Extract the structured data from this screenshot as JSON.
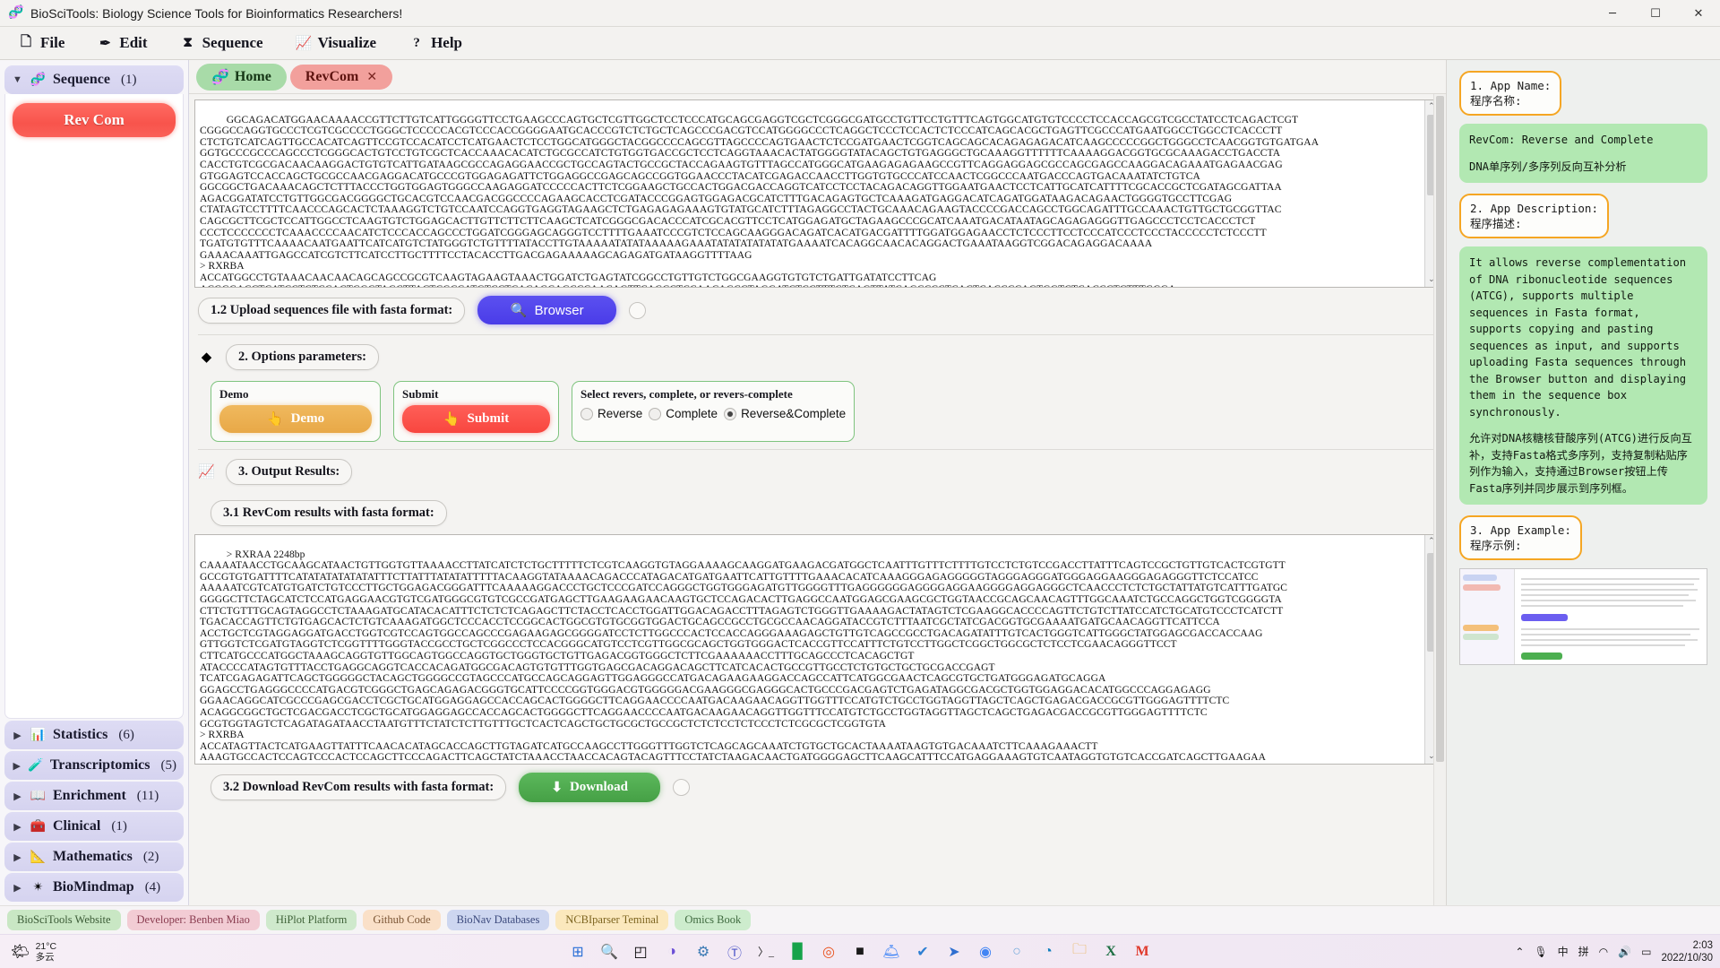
{
  "window": {
    "title": "BioSciTools: Biology Science Tools for Bioinformatics Researchers!",
    "app_icon": "dna-icon",
    "minimize": "─",
    "maximize": "☐",
    "close": "✕"
  },
  "menu": [
    {
      "label": "File",
      "icon": "file-icon",
      "glyph": "🗋"
    },
    {
      "label": "Edit",
      "icon": "pen-icon",
      "glyph": "✒"
    },
    {
      "label": "Sequence",
      "icon": "sequence-icon",
      "glyph": "⧗"
    },
    {
      "label": "Visualize",
      "icon": "chart-icon",
      "glyph": "📈"
    },
    {
      "label": "Help",
      "icon": "question-icon",
      "glyph": "?"
    }
  ],
  "sidebar": {
    "active_group": {
      "label": "Sequence",
      "count": "(1)",
      "caret": "▼",
      "icon": "dna-icon",
      "glyph": "🧬"
    },
    "active_items": [
      {
        "label": "Rev Com",
        "name": "rev-com-button"
      }
    ],
    "groups": [
      {
        "label": "Statistics",
        "count": "(6)",
        "caret": "▶",
        "icon": "statistics-icon",
        "glyph": "📊"
      },
      {
        "label": "Transcriptomics",
        "count": "(5)",
        "caret": "▶",
        "icon": "transcriptomics-icon",
        "glyph": "🧪"
      },
      {
        "label": "Enrichment",
        "count": "(11)",
        "caret": "▶",
        "icon": "enrichment-icon",
        "glyph": "📖"
      },
      {
        "label": "Clinical",
        "count": "(1)",
        "caret": "▶",
        "icon": "clinical-icon",
        "glyph": "🧰"
      },
      {
        "label": "Mathematics",
        "count": "(2)",
        "caret": "▶",
        "icon": "mathematics-icon",
        "glyph": "📐"
      },
      {
        "label": "BioMindmap",
        "count": "(4)",
        "caret": "▶",
        "icon": "mindmap-icon",
        "glyph": "✴"
      }
    ]
  },
  "tabs": [
    {
      "label": "Home",
      "icon": "dna-icon",
      "glyph": "🧬",
      "active": false,
      "closable": false
    },
    {
      "label": "RevCom",
      "icon": "none",
      "glyph": "",
      "active": true,
      "closable": true,
      "close_glyph": "✕"
    }
  ],
  "main": {
    "input_sequence": "GGCAGACATGGAACAAAACCGTTCTTGTCATTGGGGTTCCTGAAGCCCAGTGCTCGTTGGCTCCTCCCATGCAGCGAGGTCGCTCGGGCGATGCCTGTTCCTGTTTCAGTGGCATGTGTCCCCTCCACCAGCGTCGCCTATCCTCAGACTCGT\nCGGGCCAGGTGCCCTCGTCGCCCCTGGGCTCCCCCACGTCCCACCGGGGAATGCACCCGTCTCTGCTCAGCCCGACGTCCATGGGGCCCTCAGGCTCCCTCCACTCTCCCATCAGCACGCTGAGTTCGCCCATGAATGGCCTGGCCTCACCCTT\nCTCTGTCATCAGTTGCCACATCAGTTCCGTCCACATCCTCATGAACTCTCCTGGCATGGGCTACGGCCCCAGCGTTAGCCCCAGTGAACTCTCCGATGAACTCGGTCAGCAGCACAGAGAGACATCAAGCCCCCGGCTGGGCCTCAACGGTGTGATGAA\nGGTGCCCGCCCAGCCCTCGGGCACTGTCCTGTCGCTCACCAAACACATCTGCGCCATCTGTGGTGACCGCTCCTCAGGTAAACACTATGGGGTATACAGCTGTGAGGGCTGCAAAGGTTTTTTCAAAAGGACGGTGCGCAAAGACCTGACCTA\nCACCTGTCGCGACAACAAGGACTGTGTCATTGATAAGCGCCAGAGGAACCGCTGCCAGTACTGCCGCTACCAGAAGTGTTTAGCCATGGGCATGAAGAGAGAAGCCGTTCAGGAGGAGCGCCAGCGAGCCAAGGACAGAAATGAGAACGAG\nGTGGAGTCCACCAGCTGCGCCAACGAGGACATGCCCGTGGAGAGATTCTGGAGGCCGAGCAGCCGGTGGAACCCTACATCGAGACCAACCTTGGTGTGCCCATCCAACTCGGCCCAATGACCCAGTGACAAATATCTGTCA\nGGCGGCTGACAAACAGCTCTTTACCCTGGTGGAGTGGGCCAAGAGGATCCCCCACTTCTCGGAAGCTGCCACTGGACGACCAGGTCATCCTCCTACAGACAGGTTGGAATGAACTCCTCATTGCATCATTTTCGCACCGCTCGATAGCGATTAA\nAGACGGATATCCTGTTGGCGACGGGGCTGCACGTCCAACGACGGCCCCAGAAGCACCTCGATACCCGGAGTGGAGACGCATCTTTGACAGAGTGCTCAAAGATGAGGACATCAGATGGATAAGACAGAACTGGGGTGCCTTCGAG\nCTATAGTCCTTTTCAACCCAGCACTCTAAAGGTCTGTCCAATCCAGGTGAGGTAGAAGCTCTGAGAGAGAAAGTGTATGCATCTTTAGAGGCCTACTGCAAACAGAAGTACCCCGACCAGCCTGGCAGATTTGCCAAACTGTTGCTGCGGTTAC\nCAGCGCTTCGCTCCATTGGCCTCAAGTGTCTGGAGCACTTGTTCTTCTTCAAGCTCATCGGGCGACACCCATCGCACGTTCCTCATGGAGATGCTAGAAGCCCGCATCAAATGACATAATAGCAGAGAGGGTTGAGCCCTCCTCACCCTCT\nCCCTCCCCCCCTCAAACCCCAACATCTCCCACCAGCCCTGGATCGGGAGCAGGGTCCTTTTGAAATCCCGTCTCCAGCAAGGGACAGATCACATGACGATTTTGGATGGAGAACCTCTCCCTTCCTCCCATCCCTCCCTACCCCCTCTCCCTT\nTGATGTGTTTCAAAACAATGAATTCATCATGTCTATGGGTCTGTTTTATACCTTGTAAAAATATATAAAAAGAAATATATATATATATGAAAATCACAGGCAACACAGGACTGAAATAAGGTCGGACAGAGGACAAAA\nGAAACAAATTGAGCCATCGTCTTCATCCTTGCTTTTCCTACACCTTGACGAGAAAAAGCAGAGATGATAAGGTTTTAAG\n> RXRBA\nACCATGGCCTGTAAACAACAACAGCAGCCGCGTCAAGTAGAAGTAAACTGGATCTGAGTATCGGCCTGTTGTCTGGCGAAGGTGTGTCTGATTGATATCCTTCAG\nACGGGACCTCATCCTCTCCACTGGGTAGCTTACTCGCCATGTCCTCACAGCAGCCCAACAGTTCAGCCTCCAACAGCCTAGGATCTCCTTTCTCAGTTATCAGCCCCTCACTCACCCCAGTGGTCTCACCCTCTTTGGGA\nTTTGGACCCATCAGCAACAGTCAGATCTCTTCTTCAGCACCCATATCAGGGATGCACTCAATCAGCAGCTCAGAAGACA",
    "sequence_scroll": {
      "up_glyph": "⌃",
      "down_glyph": "⌄"
    },
    "upload_label": "1.2 Upload sequences file with fasta format:",
    "browser_button": "Browser",
    "browser_icon": "folder-search-icon",
    "options_header": "2. Options parameters:",
    "options_icon": "diamond-icon",
    "demo": {
      "caption": "Demo",
      "button": "Demo",
      "icon": "hand-icon"
    },
    "submit": {
      "caption": "Submit",
      "button": "Submit",
      "icon": "hand-icon"
    },
    "select": {
      "caption": "Select revers, complete, or revers-complete",
      "options": [
        {
          "label": "Reverse",
          "selected": false
        },
        {
          "label": "Complete",
          "selected": false
        },
        {
          "label": "Reverse&Complete",
          "selected": true
        }
      ]
    },
    "output_header": "3. Output Results:",
    "output_icon": "chart-check-icon",
    "results_label": "3.1 RevCom results with fasta format:",
    "output_sequence": "> RXRAA 2248bp\nCAAAATAACCTGCAAGCATAACTGTTGGTGTTAAAACCTTATCATCTCTGCTTTTTCTCGTCAAGGTGTAGGAAAAGCAAGGATGAAGACGATGGCTCAATTTGTTTCTTTTGTCCTCTGTCCGACCTTATTTCAGTCCGCTGTTGTCACTCGTGTT\nGCCGTGTGATTTTCATATATATATATATTTCTTATTTATATATTTTTACAAGGTATAAAACAGACCCATAGACATGATGAATTCATTGTTTTGAAACACATCAAAGGGAGAGGGGGTAGGGAGGGATGGGAGGAAGGGAGAGGGTTCTCCATCC\nAAAAATCGTCATGTGATCTGTCCCTTGCTGGAGACGGGATTTCAAAAAGGACCCTGCTCCCGATCCAGGGCTGGTGGGAGATGTTGGGGTTTGAGGGGGGAGGGGAGGAAGGGGAGGAGGGCTCAACCCTCTCTGCTATTATGTCATTTGATGC\nGGGGCTTCTAGCATCTCCATGAGGAACGTGTCGATGGGCGTGTCGCCGATGAGCTTGAAGAAGAACAAGTGCTCCAGACACTTGAGGCCAATGGAGCGAAGCGCTGGTAACCGCAGCAACAGTTTGGCAAATCTGCCAGGCTGGTCGGGGTA\nCTTCTGTTTGCAGTAGGCCTCTAAAGATGCATACACATTTCTCTCTCAGAGCTTCTACCTCACCTGGATTGGACAGACCTTTAGAGTCTGGGTTGAAAAGACTATAGTCTCGAAGGCACCCCAGTTCTGTCTTATCCATCTGCATGTCCCTCATCTT\nTGACACCAGTTCTGTGAGCACTCTGTCAAAGATGGCTCCCACCTCCGGCACTGGCGTGTGCGGTGGACTGCAGCCGCCTGCGCCAACAGGATACCGTCTTTAATCGCTATCGACGGTGCGAAAATGATGCAACAGGTTCATTCCA\nACCTGCTCGTAGGAGGATGACCTGGTCGTCCAGTGGCCAGCCCGAGAAGAGCGGGGATCCTCTTGGCCCACTCCACCAGGGAAAGAGCTGTTGTCAGCCGCCTGACAGATATTTGTCACTGGGTCATTGGGCTATGGAGCGACCACCAAG\nGTTGGTCTCGATGTAGGTCTCGGTTTTGGGTACCGCCTGCTCGGCCCTCCACGGGCATGTCCTCGTTGGCGCAGCTGGTGGGACTCACCGTTCCATTTCTGTCCTTGGCTCGGCTGGCGCTCTCCTCGAACAGGGTTCCT\nCTTCATGCCCATGGCTAAAGCAGGTGTTGGCAGTGGCCAGGTGCTGGGTGCTGTTGAGACGGTGGGCTCTTCGAAAAAACCTTTGCAGCCCTCACAGCTGT\nATACCCCATAGTGTTTACCTGAGGCAGGTCACCACAGATGGCGACAGTGTGTTTGGTGAGCGACAGGACAGCTTCATCACACTGCCGTTGCCTCTGTGCTGCTGCGACCGAGT\nTCATCGAGAGATTCAGCTGGGGGCTACAGCTGGGGCCGTAGCCCATGCCAGCAGGAGTTGGAGGGCCATGACAGAAGAAGGACCAGCCATTCATGGCGAACTCAGCGTGCTGATGGGAGATGCAGGA\nGGAGCCTGAGGGCCCCATGACGTCGGGCTGAGCAGAGACGGGTGCATTCCCCGGTGGGACGTGGGGGACGAAGGGCGAGGGCACTGCCCGACGAGTCTGAGATAGGCGACGCTGGTGGAGGACACATGGCCCAGGAGAGG\nGGAACAGGCATCGCCCGAGCGACCTCGCTGCATGGAGGAGCCACCAGCACTGGGGCTTCAGGAACCCCAATGACAAGAACAGGTTGGTTTCCATGTCTGCCTGGTAGGTTAGCTCAGCTGAGACGACCGCGTTGGGAGTTTTCTC\nACAGGCGGCTGCTCGACGACCTCGCTGCATGGAGGAGCCACCAGCACTGGGGCTTCAGGAACCCCAATGACAAGAACAGGTTGGTTTCCATGTCTGCCTGGTAGGTTAGCTCAGCTGAGACGACCGCGTTGGGAGTTTTCTC\nGCGTGGTAGTCTCAGATAGATAACCTAATGTTTCTATCTCTTGTTTGCTCACTCAGCTGCTGCGCTGCCGCTCTCTCCTCTCCCTCTCGCGCTCGGTGTA\n> RXRBA\nACCATAGTTACTCATGAAGTTATTTCAACACATAGCACCAGCTTGTAGATCATGCCAAGCCTTGGGTTTGGTCTCAGCAGCAAATCTGTGCTGCACTAAAATAAGTGTGACAAATCTTCAAAGAAACTT\nAAAGTGCCACTCCAGTCCCACTCCAGCTTCCCAGACTTCAGCTATCTAAACCTAACCACAGTACAGTTTCCTATCTAAGACAACTGATGGGGAGCTTCAAGCATTTCCATGAGGAAAGTGTCAATAGGTGTGTCACCGATCAGCTTGAAGAA\nGAAAAAGATGCTCCAAGCACTTCAAGCCAATGGAACGCAGCGATGGCAGCAGGAGGAGCTTAGCAAACCTTCCCTGCTGCTCGGGTATTTCTGTTTGCTGGTGAAAGCCCAATGATGCATAGACCTTTTCTCTAAGGAGCTCCACCCTCACTA",
    "download_label": "3.2 Download RevCom results with fasta format:",
    "download_button": "Download",
    "download_icon": "download-icon"
  },
  "right_panel": {
    "blocks": [
      {
        "type": "callout",
        "name": "app-name-callout",
        "text": "1. App Name:\n程序名称:"
      },
      {
        "type": "green",
        "name": "app-name-value",
        "lines": [
          "RevCom: Reverse and Complete",
          "DNA单序列/多序列反向互补分析"
        ]
      },
      {
        "type": "callout",
        "name": "app-description-callout",
        "text": "2. App Description:\n程序描述:"
      },
      {
        "type": "green",
        "name": "app-description-value",
        "lines": [
          "It allows reverse complementation of DNA ribonucleotide sequences (ATCG), supports multiple sequences in Fasta format, supports copying and pasting sequences as input, and supports uploading Fasta sequences through the Browser button and displaying them in the sequence box synchronously.",
          "允许对DNA核糖核苷酸序列(ATCG)进行反向互补，支持Fasta格式多序列，支持复制粘贴序列作为输入，支持通过Browser按钮上传Fasta序列并同步展示到序列框。"
        ]
      },
      {
        "type": "callout",
        "name": "app-example-callout",
        "text": "3. App Example:\n程序示例:"
      }
    ]
  },
  "footer_links": [
    {
      "label": "BioSciTools Website",
      "bg": "#c9e7c4",
      "fg": "#3a5a35"
    },
    {
      "label": "Developer: Benben Miao",
      "bg": "#f2ccd4",
      "fg": "#8a3d50"
    },
    {
      "label": "HiPlot Platform",
      "bg": "#cfe9cc",
      "fg": "#3f6238"
    },
    {
      "label": "Github Code",
      "bg": "#fae0c8",
      "fg": "#7a5433"
    },
    {
      "label": "BioNav Databases",
      "bg": "#cdd6f0",
      "fg": "#3c4a7d"
    },
    {
      "label": "NCBIparser Teminal",
      "bg": "#fbe8bd",
      "fg": "#7d6420"
    },
    {
      "label": "Omics Book",
      "bg": "#cdeccd",
      "fg": "#3f6a3f"
    }
  ],
  "taskbar": {
    "weather": {
      "temp": "21°C",
      "desc": "多云",
      "icon": "cloudy-icon",
      "badge": "1"
    },
    "icons": [
      {
        "name": "start-icon",
        "glyph": "⊞",
        "color": "#2a6fd6"
      },
      {
        "name": "search-icon",
        "glyph": "🔍",
        "color": "#333"
      },
      {
        "name": "task-view-icon",
        "glyph": "◰",
        "color": "#333"
      },
      {
        "name": "widgets-icon",
        "glyph": "◑",
        "color": "#6b4fd6"
      },
      {
        "name": "settings-icon",
        "glyph": "⚙",
        "color": "#3a7ab4"
      },
      {
        "name": "teams-icon",
        "glyph": "Ⓣ",
        "color": "#5059c9"
      },
      {
        "name": "terminal-icon",
        "glyph": "〉_",
        "color": "#222"
      },
      {
        "name": "onenote-icon",
        "glyph": "█",
        "color": "#16a34a"
      },
      {
        "name": "ubuntu-icon",
        "glyph": "◎",
        "color": "#e95420"
      },
      {
        "name": "sticky-notes-icon",
        "glyph": "■",
        "color": "#1a1a1a"
      },
      {
        "name": "store-icon",
        "glyph": "🛎",
        "color": "#3b82f6"
      },
      {
        "name": "vscode-icon",
        "glyph": "✔",
        "color": "#2d7fd3"
      },
      {
        "name": "powerpoint-icon",
        "glyph": "➤",
        "color": "#2f6fd0"
      },
      {
        "name": "chrome-icon",
        "glyph": "◉",
        "color": "#4285f4"
      },
      {
        "name": "r-studio-icon",
        "glyph": "○",
        "color": "#75aadb"
      },
      {
        "name": "edge-icon",
        "glyph": "◔",
        "color": "#0f7ebd"
      },
      {
        "name": "folder-icon",
        "glyph": "🗀",
        "color": "#e8a838"
      },
      {
        "name": "excel-icon",
        "glyph": "X",
        "color": "#1d6f42"
      },
      {
        "name": "mindmaster-icon",
        "glyph": "M",
        "color": "#e0392b"
      }
    ],
    "tray": {
      "chevron": "⌃",
      "mic": "🎙",
      "ime_cn": "中",
      "ime_pinyin": "拼",
      "wifi": "◠",
      "volume": "🔊",
      "battery": "▭",
      "time": "2:03",
      "date": "2022/10/30"
    }
  }
}
